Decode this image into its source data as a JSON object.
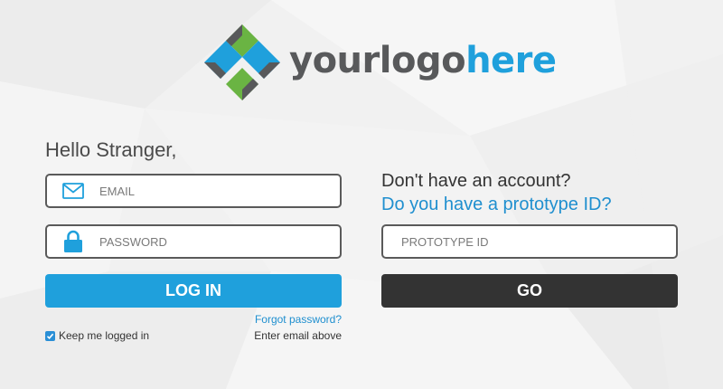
{
  "logo": {
    "text_main": "yourlogo",
    "text_accent": "here",
    "mark_icon": "diamond-logo-icon"
  },
  "login": {
    "greeting": "Hello Stranger,",
    "email_placeholder": "EMAIL",
    "password_placeholder": "PASSWORD",
    "email_icon": "envelope-icon",
    "password_icon": "lock-icon",
    "login_button": "LOG IN",
    "forgot_link": "Forgot password?",
    "forgot_hint": "Enter email above",
    "keep_logged_in": "Keep me logged in",
    "keep_logged_in_checked": true
  },
  "prototype": {
    "no_account": "Don't have an account?",
    "question": "Do you have a prototype ID?",
    "id_placeholder": "PROTOTYPE ID",
    "go_button": "GO"
  },
  "colors": {
    "accent": "#1fa0dc",
    "dark_button": "#333333",
    "logo_green": "#6ab443",
    "logo_gray": "#58595b"
  }
}
